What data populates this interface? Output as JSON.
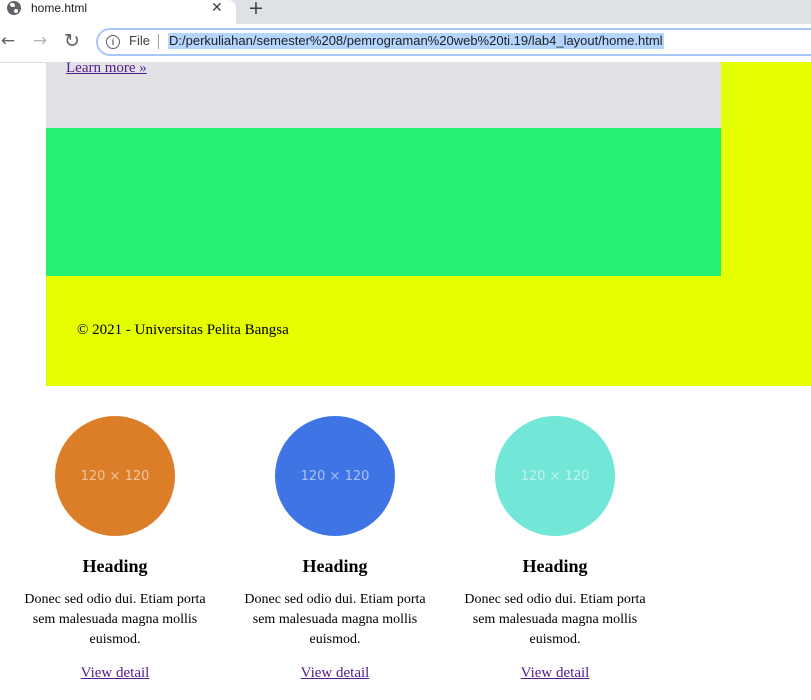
{
  "browser": {
    "tab_title": "home.html",
    "close_glyph": "✕",
    "new_tab_glyph": "+",
    "back_glyph": "←",
    "forward_glyph": "→",
    "reload_glyph": "↻",
    "info_glyph": "i",
    "file_label": "File",
    "url": "D:/perkuliahan/semester%208/pemrograman%20web%20ti.19/lab4_layout/home.html"
  },
  "page": {
    "learn_more": "Learn more »",
    "footer_text": "© 2021 - Universitas Pelita Bangsa",
    "colors": {
      "jumbotron": "#e1e2e6",
      "green": "#24f073",
      "yellow": "#e5ff00"
    },
    "columns": [
      {
        "placeholder": "120 × 120",
        "color": "#dc7e27",
        "heading": "Heading",
        "text": "Donec sed odio dui. Etiam porta sem malesuada magna mollis euismod.",
        "link": "View detail"
      },
      {
        "placeholder": "120 × 120",
        "color": "#3f74e4",
        "heading": "Heading",
        "text": "Donec sed odio dui. Etiam porta sem malesuada magna mollis euismod.",
        "link": "View detail"
      },
      {
        "placeholder": "120 × 120",
        "color": "#72e6d7",
        "heading": "Heading",
        "text": "Donec sed odio dui. Etiam porta sem malesuada magna mollis euismod.",
        "link": "View detail"
      }
    ]
  }
}
